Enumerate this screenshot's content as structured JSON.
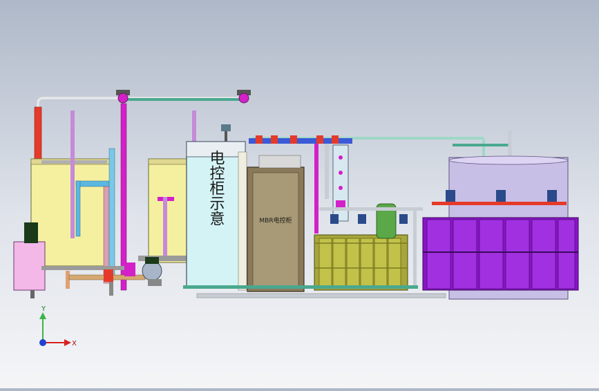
{
  "cabinet_label_vertical": "电控柜示意",
  "mbr_cabinet_label": "MBR电控柜",
  "triad": {
    "x_label": "X",
    "y_label": "Y"
  },
  "colors": {
    "tank_yellow": "#f5f0a0",
    "cabinet_cyan": "#d4f3f5",
    "mbr_brown": "#8a7a5a",
    "membrane_olive": "#a6a63a",
    "drum_purple": "#8a14c8",
    "big_tank_lavender": "#c8bfe6",
    "pipe_teal": "#4aa88e",
    "pipe_magenta": "#d420c8",
    "pipe_red": "#e53a2a",
    "pump_pink": "#f3b8e8"
  }
}
